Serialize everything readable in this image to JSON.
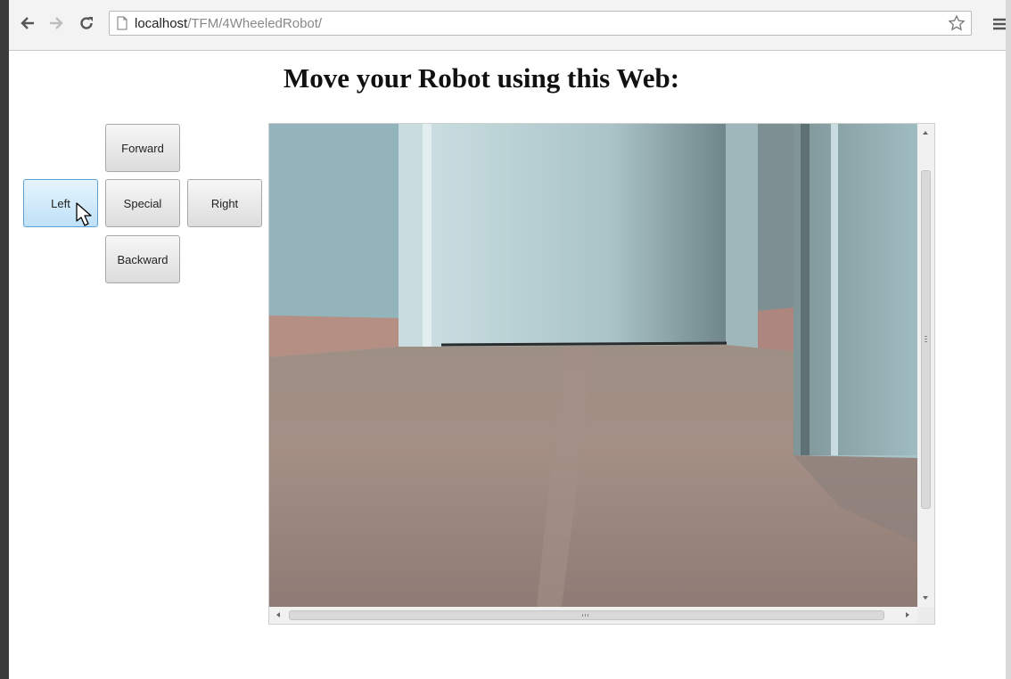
{
  "browser": {
    "url_host": "localhost",
    "url_path": "/TFM/4WheeledRobot/",
    "icons": [
      "back-arrow-icon",
      "forward-arrow-icon",
      "reload-icon",
      "page-icon",
      "bookmark-star-icon",
      "menu-icon"
    ]
  },
  "page": {
    "title": "Move your Robot using this Web:"
  },
  "controls": {
    "forward": "Forward",
    "left": "Left",
    "special": "Special",
    "right": "Right",
    "backward": "Backward",
    "active": "left"
  },
  "colors": {
    "active_button": "#bfe1f8",
    "button": "#e6e6e6"
  }
}
